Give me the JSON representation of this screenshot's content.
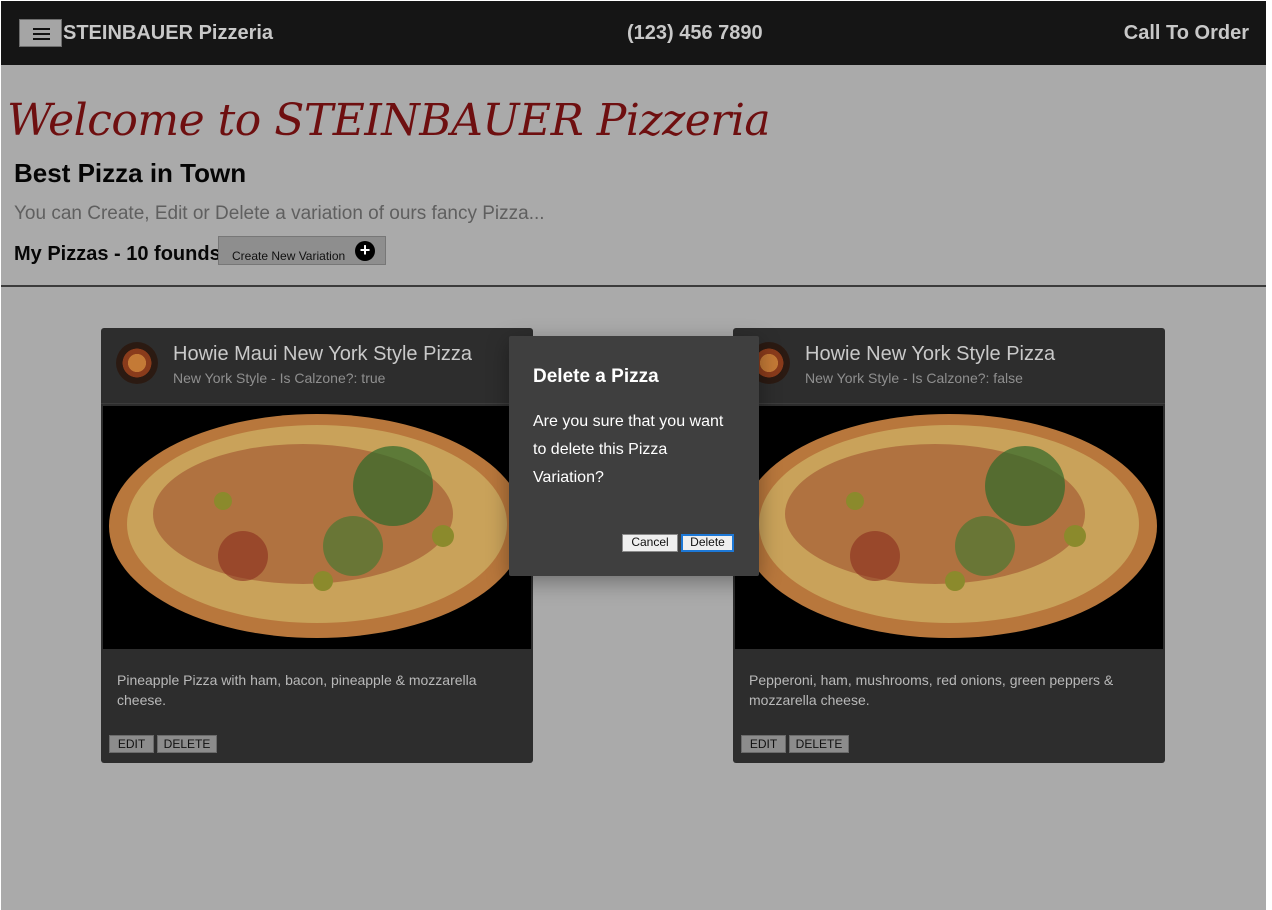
{
  "header": {
    "brand": "STEINBAUER Pizzeria",
    "phone": "(123) 456 7890",
    "call_to_order": "Call To Order",
    "menu_icon": "hamburger-menu-icon"
  },
  "main": {
    "welcome": "Welcome to STEINBAUER Pizzeria",
    "subtitle": "Best Pizza in Town",
    "lead": "You can Create, Edit or Delete a variation of ours fancy Pizza...",
    "count": "My Pizzas - 10 founds",
    "create_button": "Create New Variation",
    "create_icon": "plus-circle-icon"
  },
  "cards": [
    {
      "title": "Howie Maui New York Style Pizza",
      "subtitle": "New York Style - Is Calzone?: true",
      "description": "Pineapple Pizza with ham, bacon, pineapple & mozzarella cheese.",
      "edit": "EDIT",
      "delete": "DELETE"
    },
    {
      "title": "Howie New York Style Pizza",
      "subtitle": "New York Style - Is Calzone?: false",
      "description": "Pepperoni, ham, mushrooms, red onions, green peppers & mozzarella cheese.",
      "edit": "EDIT",
      "delete": "DELETE"
    }
  ],
  "modal": {
    "title": "Delete a Pizza",
    "text": "Are you sure that you want to delete this Pizza Variation?",
    "cancel": "Cancel",
    "delete": "Delete"
  },
  "colors": {
    "topbar": "#151515",
    "overlay_background": "#aaaaaa",
    "welcome_text": "#6e0f10",
    "card_background": "#2d2d2d",
    "modal_background": "#3f3f3f",
    "focus_outline": "#1d78d6"
  }
}
